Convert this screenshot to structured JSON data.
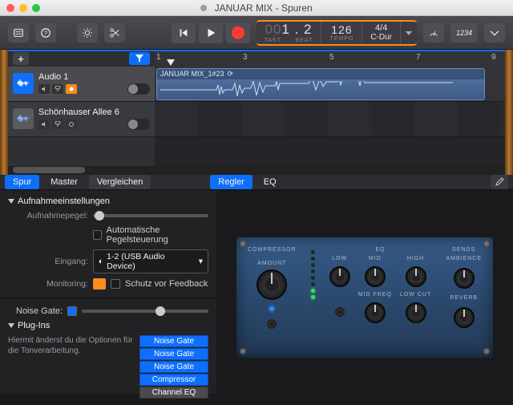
{
  "window": {
    "title": "JANUAR MIX - Spuren"
  },
  "toolbar": {
    "library_icon": "library",
    "help_icon": "help",
    "settings_icon": "settings",
    "scissors_icon": "scissors",
    "pencil_icon": "pencil",
    "counter_icon": "1234",
    "more_icon": "more"
  },
  "transport": {
    "lcd_big": "1 . 2",
    "lcd_takt": "TAKT",
    "lcd_beat": "BEAT",
    "tempo": "126",
    "tempo_label": "TEMPO",
    "sig": "4/4",
    "key": "C-Dur"
  },
  "ruler": {
    "ticks": [
      "1",
      "3",
      "5",
      "7",
      "9"
    ]
  },
  "tracks": [
    {
      "name": "Audio 1",
      "selected": true,
      "clip": {
        "title": "JANUAR MIX_1#23",
        "loop": true
      }
    },
    {
      "name": "Schönhauser Allee 6",
      "selected": false
    }
  ],
  "tabs": {
    "left": [
      "Spur",
      "Master",
      "Vergleichen"
    ],
    "right": [
      "Regler",
      "EQ"
    ]
  },
  "inspector": {
    "section_rec": "Aufnahmeeinstellungen",
    "level_label": "Aufnahmepegel:",
    "auto_level": "Automatische Pegelsteuerung",
    "input_label": "Eingang:",
    "input_value": "1-2  (USB Audio Device)",
    "monitoring_label": "Monitoring:",
    "feedback": "Schutz vor Feedback",
    "noise_gate_label": "Noise Gate:",
    "section_plugins": "Plug-Ins",
    "plugins_hint": "Hiermit änderst du die Optionen für die Tonverarbeitung.",
    "plugins": [
      "Noise Gate",
      "Noise Gate",
      "Noise Gate",
      "Compressor",
      "Channel EQ"
    ]
  },
  "rack": {
    "comp": "COMPRESSOR",
    "amount": "AMOUNT",
    "eq": "EQ",
    "low": "LOW",
    "mid": "MID",
    "high": "HIGH",
    "midfreq": "MID FREQ",
    "lowcut": "LOW CUT",
    "sends": "SENDS",
    "ambience": "AMBIENCE",
    "reverb": "REVERB"
  }
}
